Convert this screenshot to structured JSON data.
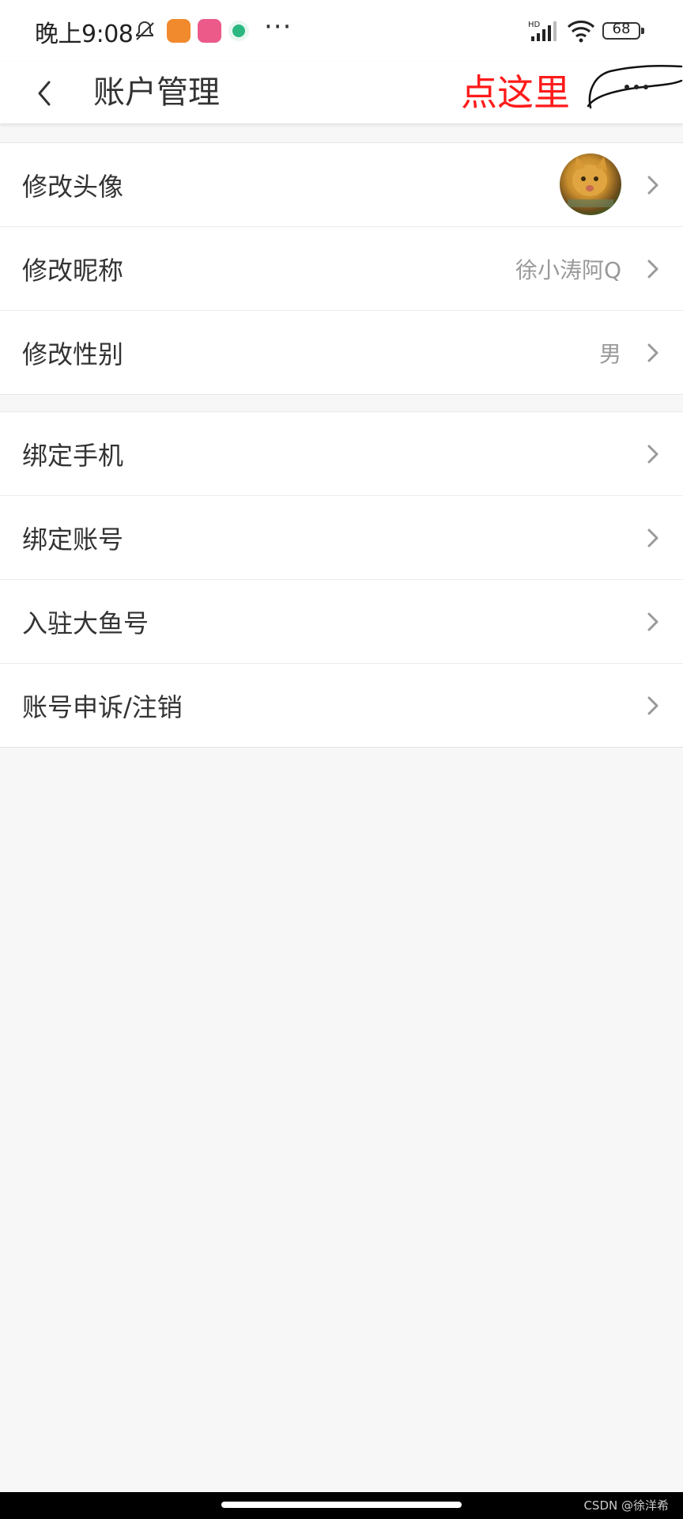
{
  "status_bar": {
    "time": "晚上9:08",
    "more": "···",
    "network": "HD",
    "battery": "68"
  },
  "nav": {
    "title": "账户管理",
    "annotation": "点这里"
  },
  "group1": [
    {
      "label": "修改头像",
      "value": ""
    },
    {
      "label": "修改昵称",
      "value": "徐小涛阿Q"
    },
    {
      "label": "修改性别",
      "value": "男"
    }
  ],
  "group2": [
    {
      "label": "绑定手机"
    },
    {
      "label": "绑定账号"
    },
    {
      "label": "入驻大鱼号"
    },
    {
      "label": "账号申诉/注销"
    }
  ],
  "watermark": "CSDN @徐洋希",
  "colors": {
    "annotation": "#ff1a1a",
    "background": "#f7f7f7",
    "value_text": "#999999"
  }
}
